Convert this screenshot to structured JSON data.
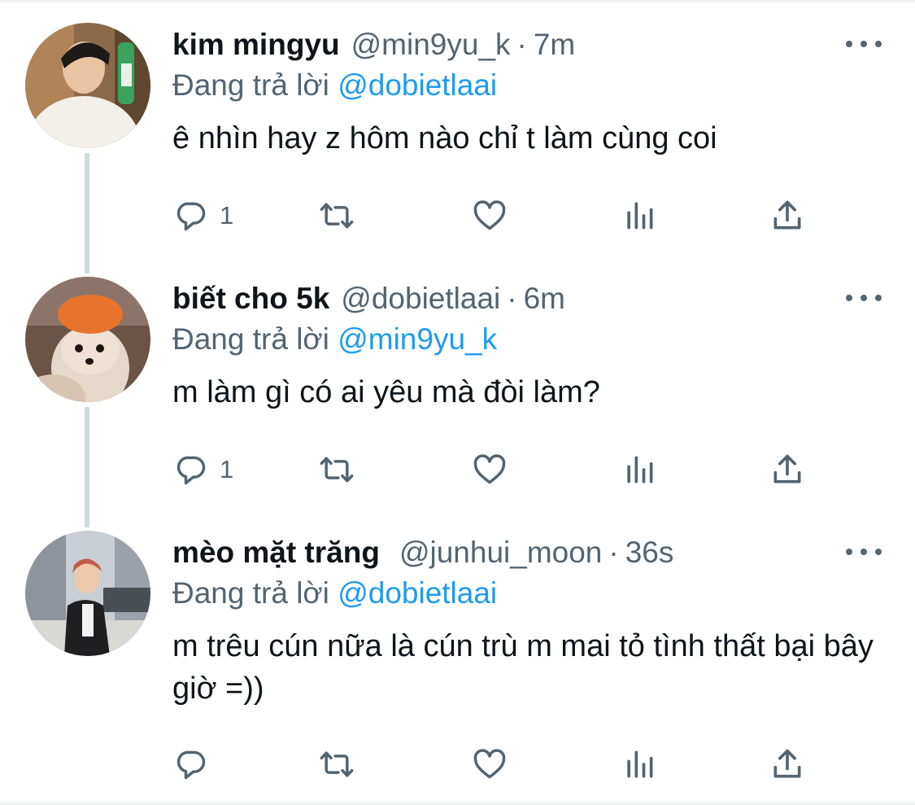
{
  "tweets": [
    {
      "name": "kim mingyu",
      "handle": "@min9yu_k",
      "dot": "·",
      "time": "7m",
      "replying_prefix": "Đang trả lời",
      "replying_to": "@dobietlaai",
      "text": "ê nhìn hay z hôm nào chỉ t làm cùng coi",
      "reply_count": "1"
    },
    {
      "name": "biết cho 5k",
      "handle": "@dobietlaai",
      "dot": "·",
      "time": "6m",
      "replying_prefix": "Đang trả lời",
      "replying_to": "@min9yu_k",
      "text": "m làm gì có ai yêu mà đòi làm?",
      "reply_count": "1"
    },
    {
      "name": "mèo mặt trăng",
      "handle": "@junhui_moon",
      "dot": "·",
      "time": "36s",
      "replying_prefix": "Đang trả lời",
      "replying_to": "@dobietlaai",
      "text": "m trêu cún nữa là cún trù m mai tỏ tình thất bại bây giờ =))",
      "reply_count": ""
    }
  ],
  "icons": {
    "reply": "reply-icon",
    "retweet": "retweet-icon",
    "like": "heart-icon",
    "views": "analytics-icon",
    "share": "share-icon",
    "more": "more-icon"
  },
  "colors": {
    "text": "#0f1419",
    "secondary": "#536471",
    "accent": "#1d9bf0",
    "thread_line": "#cfd9de"
  }
}
